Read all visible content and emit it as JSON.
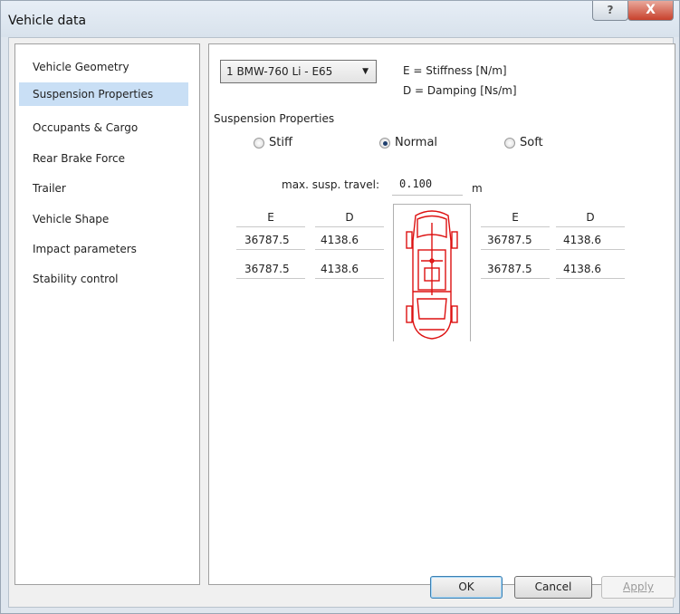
{
  "window": {
    "title": "Vehicle data",
    "help_label": "?",
    "close_label": "X"
  },
  "sidebar": {
    "items": [
      {
        "label": "Vehicle Geometry"
      },
      {
        "label": "Suspension Properties"
      },
      {
        "label": "Occupants & Cargo"
      },
      {
        "label": "Rear Brake Force"
      },
      {
        "label": "Trailer"
      },
      {
        "label": "Vehicle Shape"
      },
      {
        "label": "Impact parameters"
      },
      {
        "label": "Stability control"
      }
    ],
    "selected": "Suspension Properties"
  },
  "vehicle_select": {
    "value": "1 BMW-760 Li - E65"
  },
  "legend": {
    "stiffness": "E = Stiffness [N/m]",
    "damping": "D = Damping [Ns/m]"
  },
  "suspension": {
    "group_label": "Suspension Properties",
    "options": [
      {
        "label": "Stiff",
        "checked": false
      },
      {
        "label": "Normal",
        "checked": true
      },
      {
        "label": "Soft",
        "checked": false
      }
    ],
    "travel_label": "max. susp. travel:",
    "travel_value": "0.100",
    "travel_unit": "m",
    "left": {
      "headers": {
        "e": "E",
        "d": "D"
      },
      "rows": [
        {
          "e": "36787.5",
          "d": "4138.6"
        },
        {
          "e": "36787.5",
          "d": "4138.6"
        }
      ]
    },
    "right": {
      "headers": {
        "e": "E",
        "d": "D"
      },
      "rows": [
        {
          "e": "36787.5",
          "d": "4138.6"
        },
        {
          "e": "36787.5",
          "d": "4138.6"
        }
      ]
    }
  },
  "buttons": {
    "ok": "OK",
    "cancel": "Cancel",
    "apply": "Apply"
  },
  "colors": {
    "selection": "#c9dff5",
    "car_outline": "#dd1111",
    "close": "#c8412c"
  }
}
